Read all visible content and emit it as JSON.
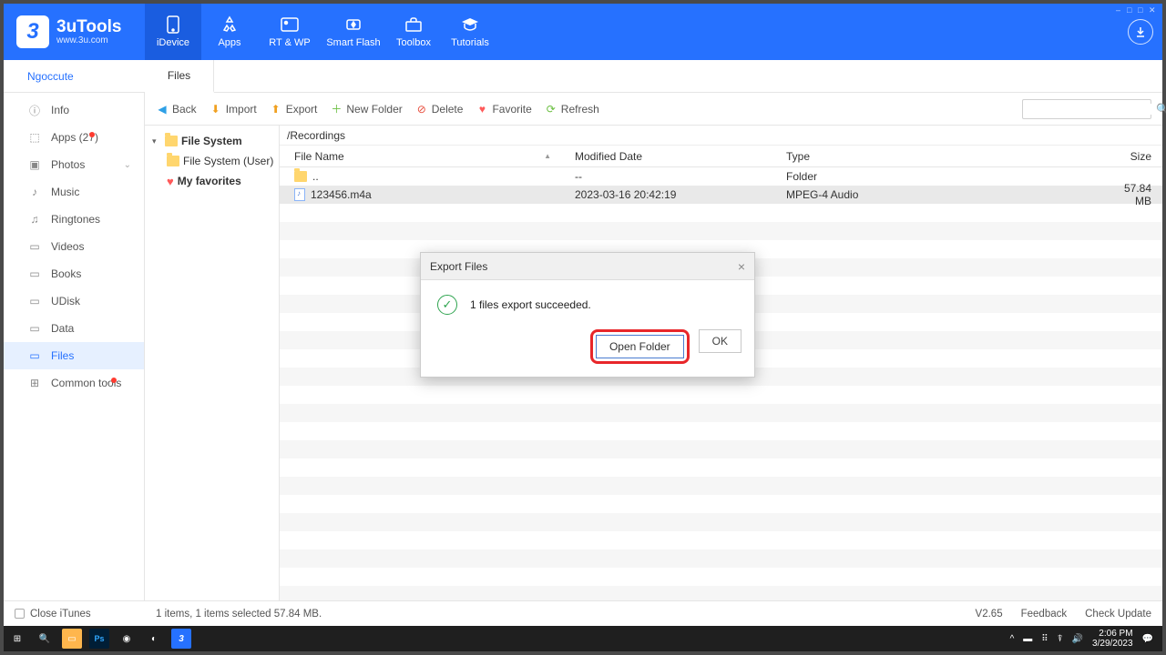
{
  "app": {
    "title": "3uTools",
    "subtitle": "www.3u.com"
  },
  "nav": [
    {
      "label": "iDevice"
    },
    {
      "label": "Apps"
    },
    {
      "label": "RT & WP"
    },
    {
      "label": "Smart Flash"
    },
    {
      "label": "Toolbox"
    },
    {
      "label": "Tutorials"
    }
  ],
  "user": "Ngoccute",
  "subTab": "Files",
  "sidebar": [
    {
      "label": "Info"
    },
    {
      "label": "Apps  (27)"
    },
    {
      "label": "Photos"
    },
    {
      "label": "Music"
    },
    {
      "label": "Ringtones"
    },
    {
      "label": "Videos"
    },
    {
      "label": "Books"
    },
    {
      "label": "UDisk"
    },
    {
      "label": "Data"
    },
    {
      "label": "Files"
    },
    {
      "label": "Common tools"
    }
  ],
  "toolbar": {
    "back": "Back",
    "import": "Import",
    "export": "Export",
    "newfolder": "New Folder",
    "delete": "Delete",
    "favorite": "Favorite",
    "refresh": "Refresh"
  },
  "tree": {
    "root": "File System",
    "user": "File System (User)",
    "fav": "My favorites"
  },
  "path": "/Recordings",
  "columns": {
    "name": "File Name",
    "mod": "Modified Date",
    "type": "Type",
    "size": "Size"
  },
  "rows": [
    {
      "name": "..",
      "mod": "--",
      "type": "Folder",
      "size": "",
      "icon": "folder"
    },
    {
      "name": "123456.m4a",
      "mod": "2023-03-16 20:42:19",
      "type": "MPEG-4 Audio",
      "size": "57.84 MB",
      "icon": "audio"
    }
  ],
  "modal": {
    "title": "Export Files",
    "msg": "1 files export succeeded.",
    "open": "Open Folder",
    "ok": "OK"
  },
  "status": {
    "closeitunes": "Close iTunes",
    "summary": "1 items, 1 items selected 57.84 MB.",
    "version": "V2.65",
    "feedback": "Feedback",
    "update": "Check Update"
  },
  "taskbar": {
    "time": "2:06 PM",
    "date": "3/29/2023"
  }
}
